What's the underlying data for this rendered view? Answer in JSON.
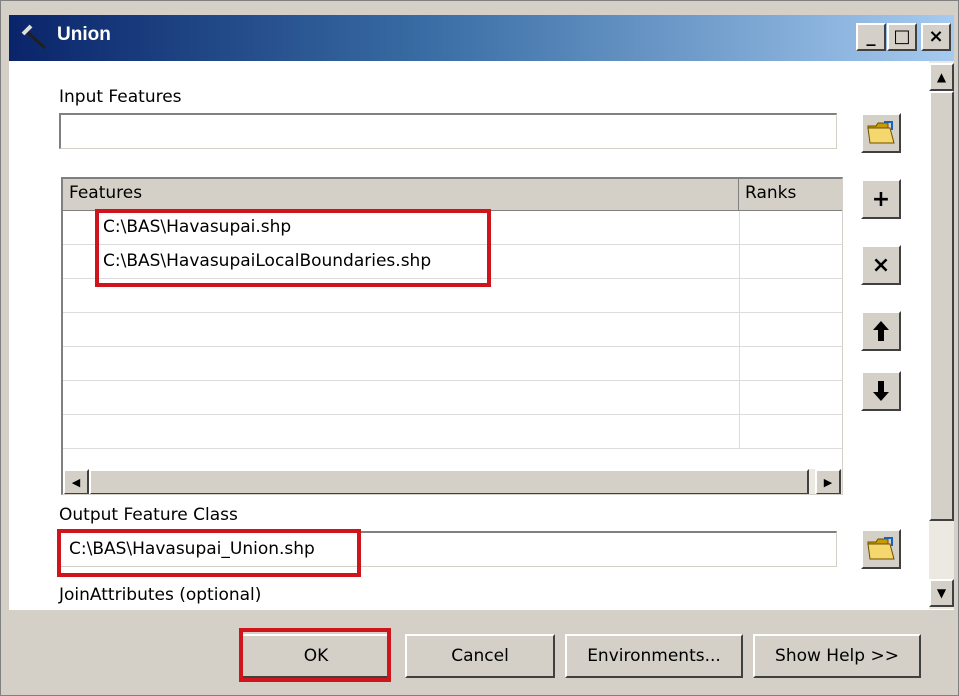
{
  "window": {
    "title": "Union",
    "title_icon": "hammer-icon",
    "controls": {
      "minimize": "_",
      "maximize": "□",
      "close": "×"
    }
  },
  "input_features": {
    "label": "Input Features",
    "value": ""
  },
  "features_table": {
    "columns": [
      "Features",
      "Ranks"
    ],
    "rows": [
      {
        "feature": "C:\\BAS\\Havasupai.shp",
        "rank": ""
      },
      {
        "feature": "C:\\BAS\\HavasupaiLocalBoundaries.shp",
        "rank": ""
      }
    ]
  },
  "side_buttons": {
    "add": "+",
    "remove": "×",
    "up": "🡑",
    "down": "🡓"
  },
  "output_feature_class": {
    "label": "Output Feature Class",
    "value": "C:\\BAS\\Havasupai_Union.shp"
  },
  "join_attributes": {
    "label": "JoinAttributes (optional)"
  },
  "buttons": {
    "ok": "OK",
    "cancel": "Cancel",
    "environments": "Environments...",
    "show_help": "Show Help >>"
  },
  "colors": {
    "highlight": "#d0141c",
    "titlebar_start": "#0a246a",
    "titlebar_end": "#a6caf0",
    "face": "#d4d0c8"
  }
}
